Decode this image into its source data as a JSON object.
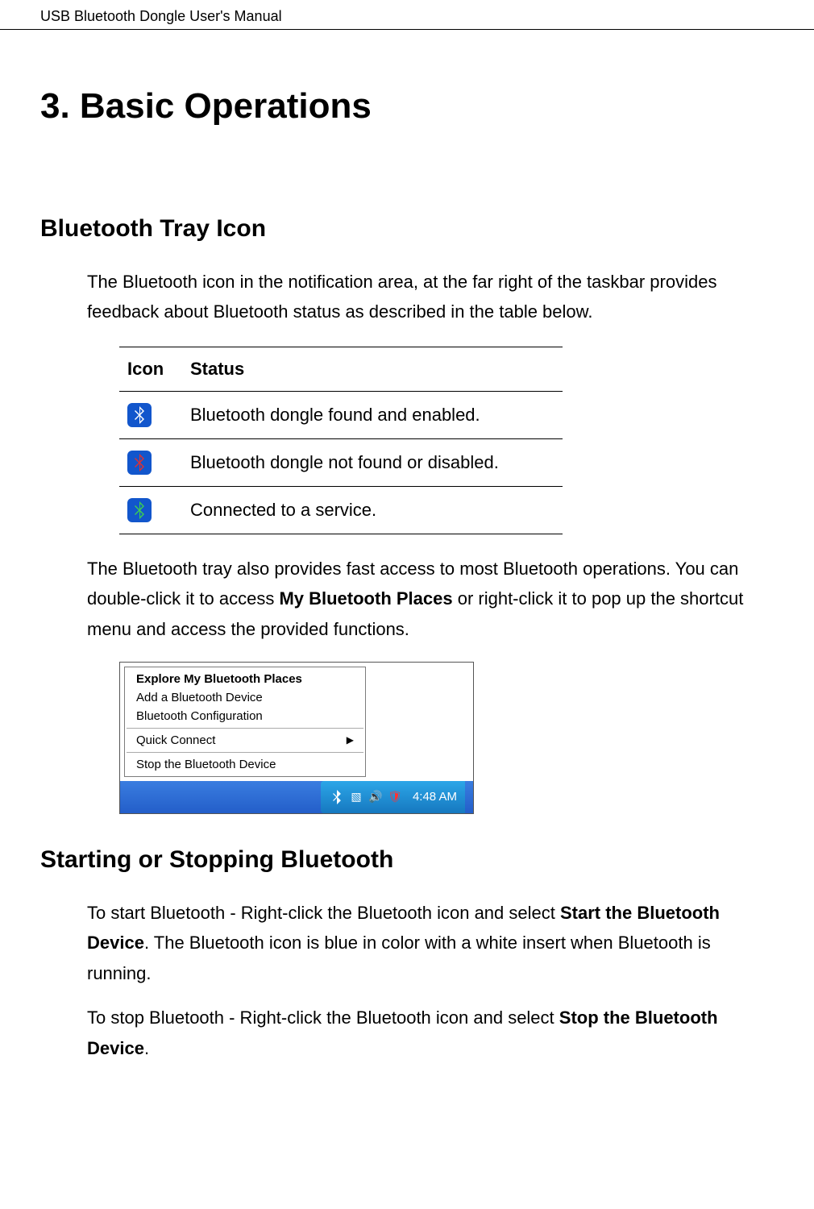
{
  "header": {
    "title": "USB Bluetooth Dongle User's Manual"
  },
  "chapter": {
    "title": "3. Basic Operations"
  },
  "section1": {
    "title": "Bluetooth Tray Icon",
    "intro": "The Bluetooth icon in the notification area, at the far right of the taskbar provides feedback about Bluetooth status as described in the table below.",
    "table": {
      "header_icon": "Icon",
      "header_status": "Status",
      "rows": [
        {
          "status": "Bluetooth dongle found and enabled."
        },
        {
          "status": "Bluetooth dongle not found or disabled."
        },
        {
          "status": "Connected to a service."
        }
      ]
    },
    "para2_a": "The Bluetooth tray also provides fast access to most Bluetooth operations. You can double-click it to access ",
    "para2_bold": "My Bluetooth Places",
    "para2_b": " or right-click it to pop up the shortcut menu and access the provided functions."
  },
  "menu": {
    "items": [
      "Explore My Bluetooth Places",
      "Add a Bluetooth Device",
      "Bluetooth Configuration",
      "Quick Connect",
      "Stop the Bluetooth Device"
    ]
  },
  "taskbar": {
    "time": "4:48 AM"
  },
  "section2": {
    "title": "Starting or Stopping Bluetooth",
    "para1_a": "To start Bluetooth - Right-click the Bluetooth icon and select ",
    "para1_bold": "Start the Bluetooth Device",
    "para1_b": ". The Bluetooth icon is blue in color with a white insert when Bluetooth is running.",
    "para2_a": "To stop Bluetooth - Right-click the Bluetooth icon and select ",
    "para2_bold": "Stop the Bluetooth Device",
    "para2_b": "."
  }
}
